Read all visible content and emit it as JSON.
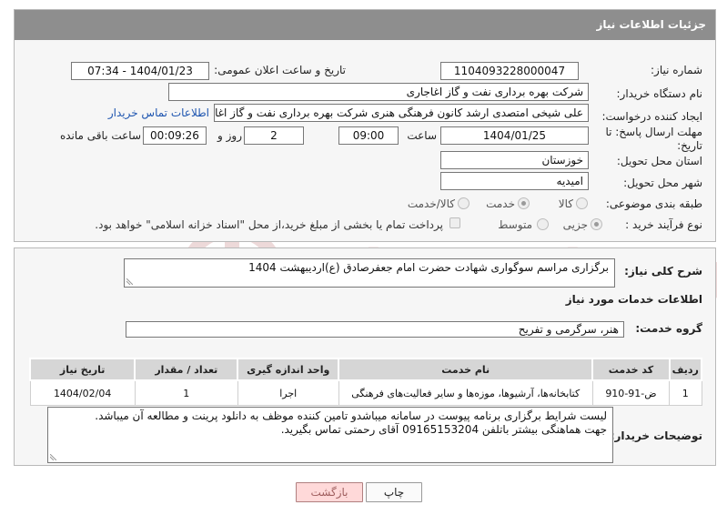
{
  "header": {
    "title": "جزئیات اطلاعات نیاز"
  },
  "form": {
    "need_number_label": "شماره نیاز:",
    "need_number": "1104093228000047",
    "announce_label": "تاریخ و ساعت اعلان عمومی:",
    "announce_value": "1404/01/23 - 07:34",
    "buyer_org_label": "نام دستگاه خریدار:",
    "buyer_org": "شرکت بهره برداری نفت و گاز اغاجاری",
    "creator_label": "ایجاد کننده درخواست:",
    "creator": "علی شیخی امتصدی ارشد کانون فرهنگی هنری شرکت بهره برداری نفت و گاز اغاجاری",
    "buyer_contact_link": "اطلاعات تماس خریدار",
    "deadline_label_line1": "مهلت ارسال پاسخ: تا",
    "deadline_label_line2": "تاریخ:",
    "deadline_date": "1404/01/25",
    "time_label": "ساعت",
    "deadline_time": "09:00",
    "days_value": "2",
    "days_label": "روز و",
    "remaining_value": "00:09:26",
    "remaining_label": "ساعت باقی مانده",
    "province_label": "استان محل تحویل:",
    "province": "خوزستان",
    "city_label": "شهر محل تحویل:",
    "city": "امیدیه",
    "category_label": "طبقه بندی موضوعی:",
    "category_options": [
      "کالا",
      "خدمت",
      "کالا/خدمت"
    ],
    "category_selected": "خدمت",
    "process_label": "نوع فرآیند خرید :",
    "process_options": [
      "جزیی",
      "متوسط"
    ],
    "process_selected": "جزیی",
    "payment_note": "پرداخت تمام یا بخشی از مبلغ خرید،از محل \"اسناد خزانه اسلامی\" خواهد بود."
  },
  "summary": {
    "label": "شرح کلی نیاز:",
    "text": "برگزاری مراسم سوگواری شهادت حضرت امام جعفرصادق (ع)اردیبهشت 1404"
  },
  "services": {
    "section_title": "اطلاعات خدمات مورد نیاز",
    "group_label": "گروه خدمت:",
    "group_value": "هنر، سرگرمی و تفریح",
    "columns": [
      "ردیف",
      "کد خدمت",
      "نام خدمت",
      "واحد اندازه گیری",
      "تعداد / مقدار",
      "تاریخ نیاز"
    ],
    "rows": [
      [
        "1",
        "ض-91-910",
        "کتابخانه‌ها، آرشیوها، موزه‌ها و سایر فعالیت‌های فرهنگی",
        "اجرا",
        "1",
        "1404/02/04"
      ]
    ]
  },
  "buyer_notes": {
    "label": "توضیحات خریدار:",
    "line1": "لیست شرایط برگزاری برنامه پیوست در سامانه میباشدو تامین کننده موظف به دانلود پرینت و مطالعه آن میباشد.",
    "line2": "جهت هماهنگی بیشتر باتلفن 09165153204 آقای رحمتی تماس بگیرید."
  },
  "buttons": {
    "print": "چاپ",
    "back": "بازگشت"
  },
  "watermark": {
    "text": "AriaTender.neT"
  },
  "colors": {
    "header_bg": "#8e8e8e",
    "link": "#1f56b0",
    "back_btn_bg": "#ffd9d9",
    "watermark": "#d2a8a8"
  }
}
